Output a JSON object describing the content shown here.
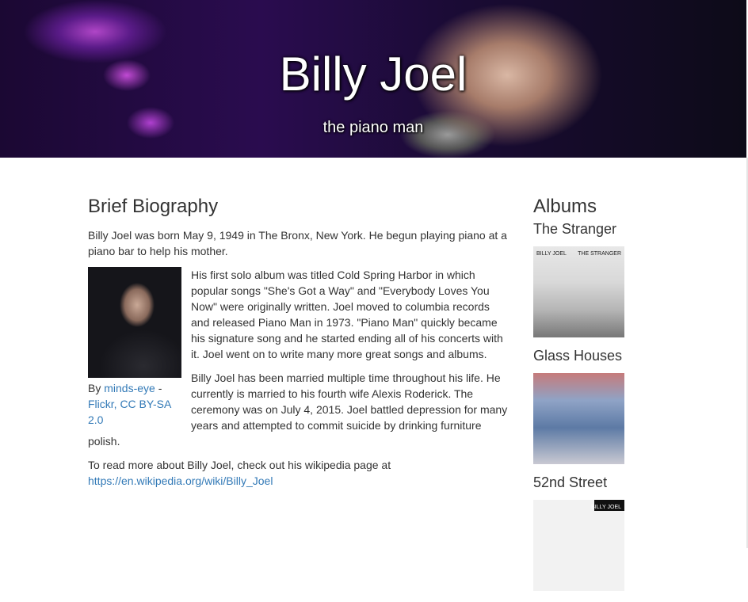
{
  "hero": {
    "title": "Billy Joel",
    "subtitle": "the piano man"
  },
  "bio": {
    "heading": "Brief Biography",
    "intro": "Billy Joel was born May 9, 1949 in The Bronx, New York. He begun playing piano at a piano bar to help his mother.",
    "image_caption_prefix": "By ",
    "image_caption_author": "minds-eye",
    "image_caption_sep": " - ",
    "image_caption_license": "Flickr, CC BY-SA 2.0",
    "paragraph_1": "His first solo album was titled Cold Spring Harbor in which popular songs \"She's Got a Way\" and \"Everybody Loves You Now\" were originally written. Joel moved to columbia records and released Piano Man in 1973. \"Piano Man\" quickly became his signature song and he started ending all of his concerts with it. Joel went on to write many more great songs and albums.",
    "paragraph_2": "Billy Joel has been married multiple time throughout his life. He currently is married to his fourth wife Alexis Roderick. The ceremony was on July 4, 2015. Joel battled depression for many years and attempted to commit suicide by drinking furniture polish.",
    "more_text": "To read more about Billy Joel, check out his wikipedia page at",
    "more_link": "https://en.wikipedia.org/wiki/Billy_Joel"
  },
  "albums": {
    "heading": "Albums",
    "items": [
      {
        "title": "The Stranger",
        "cover_text_left": "BILLY JOEL",
        "cover_text_right": "THE STRANGER"
      },
      {
        "title": "Glass Houses",
        "cover_text_left": "",
        "cover_text_right": ""
      },
      {
        "title": "52nd Street",
        "cover_text_left": "",
        "cover_text_right": "BILLY JOEL"
      }
    ]
  },
  "colors": {
    "link": "#337ab7",
    "text": "#333333"
  }
}
